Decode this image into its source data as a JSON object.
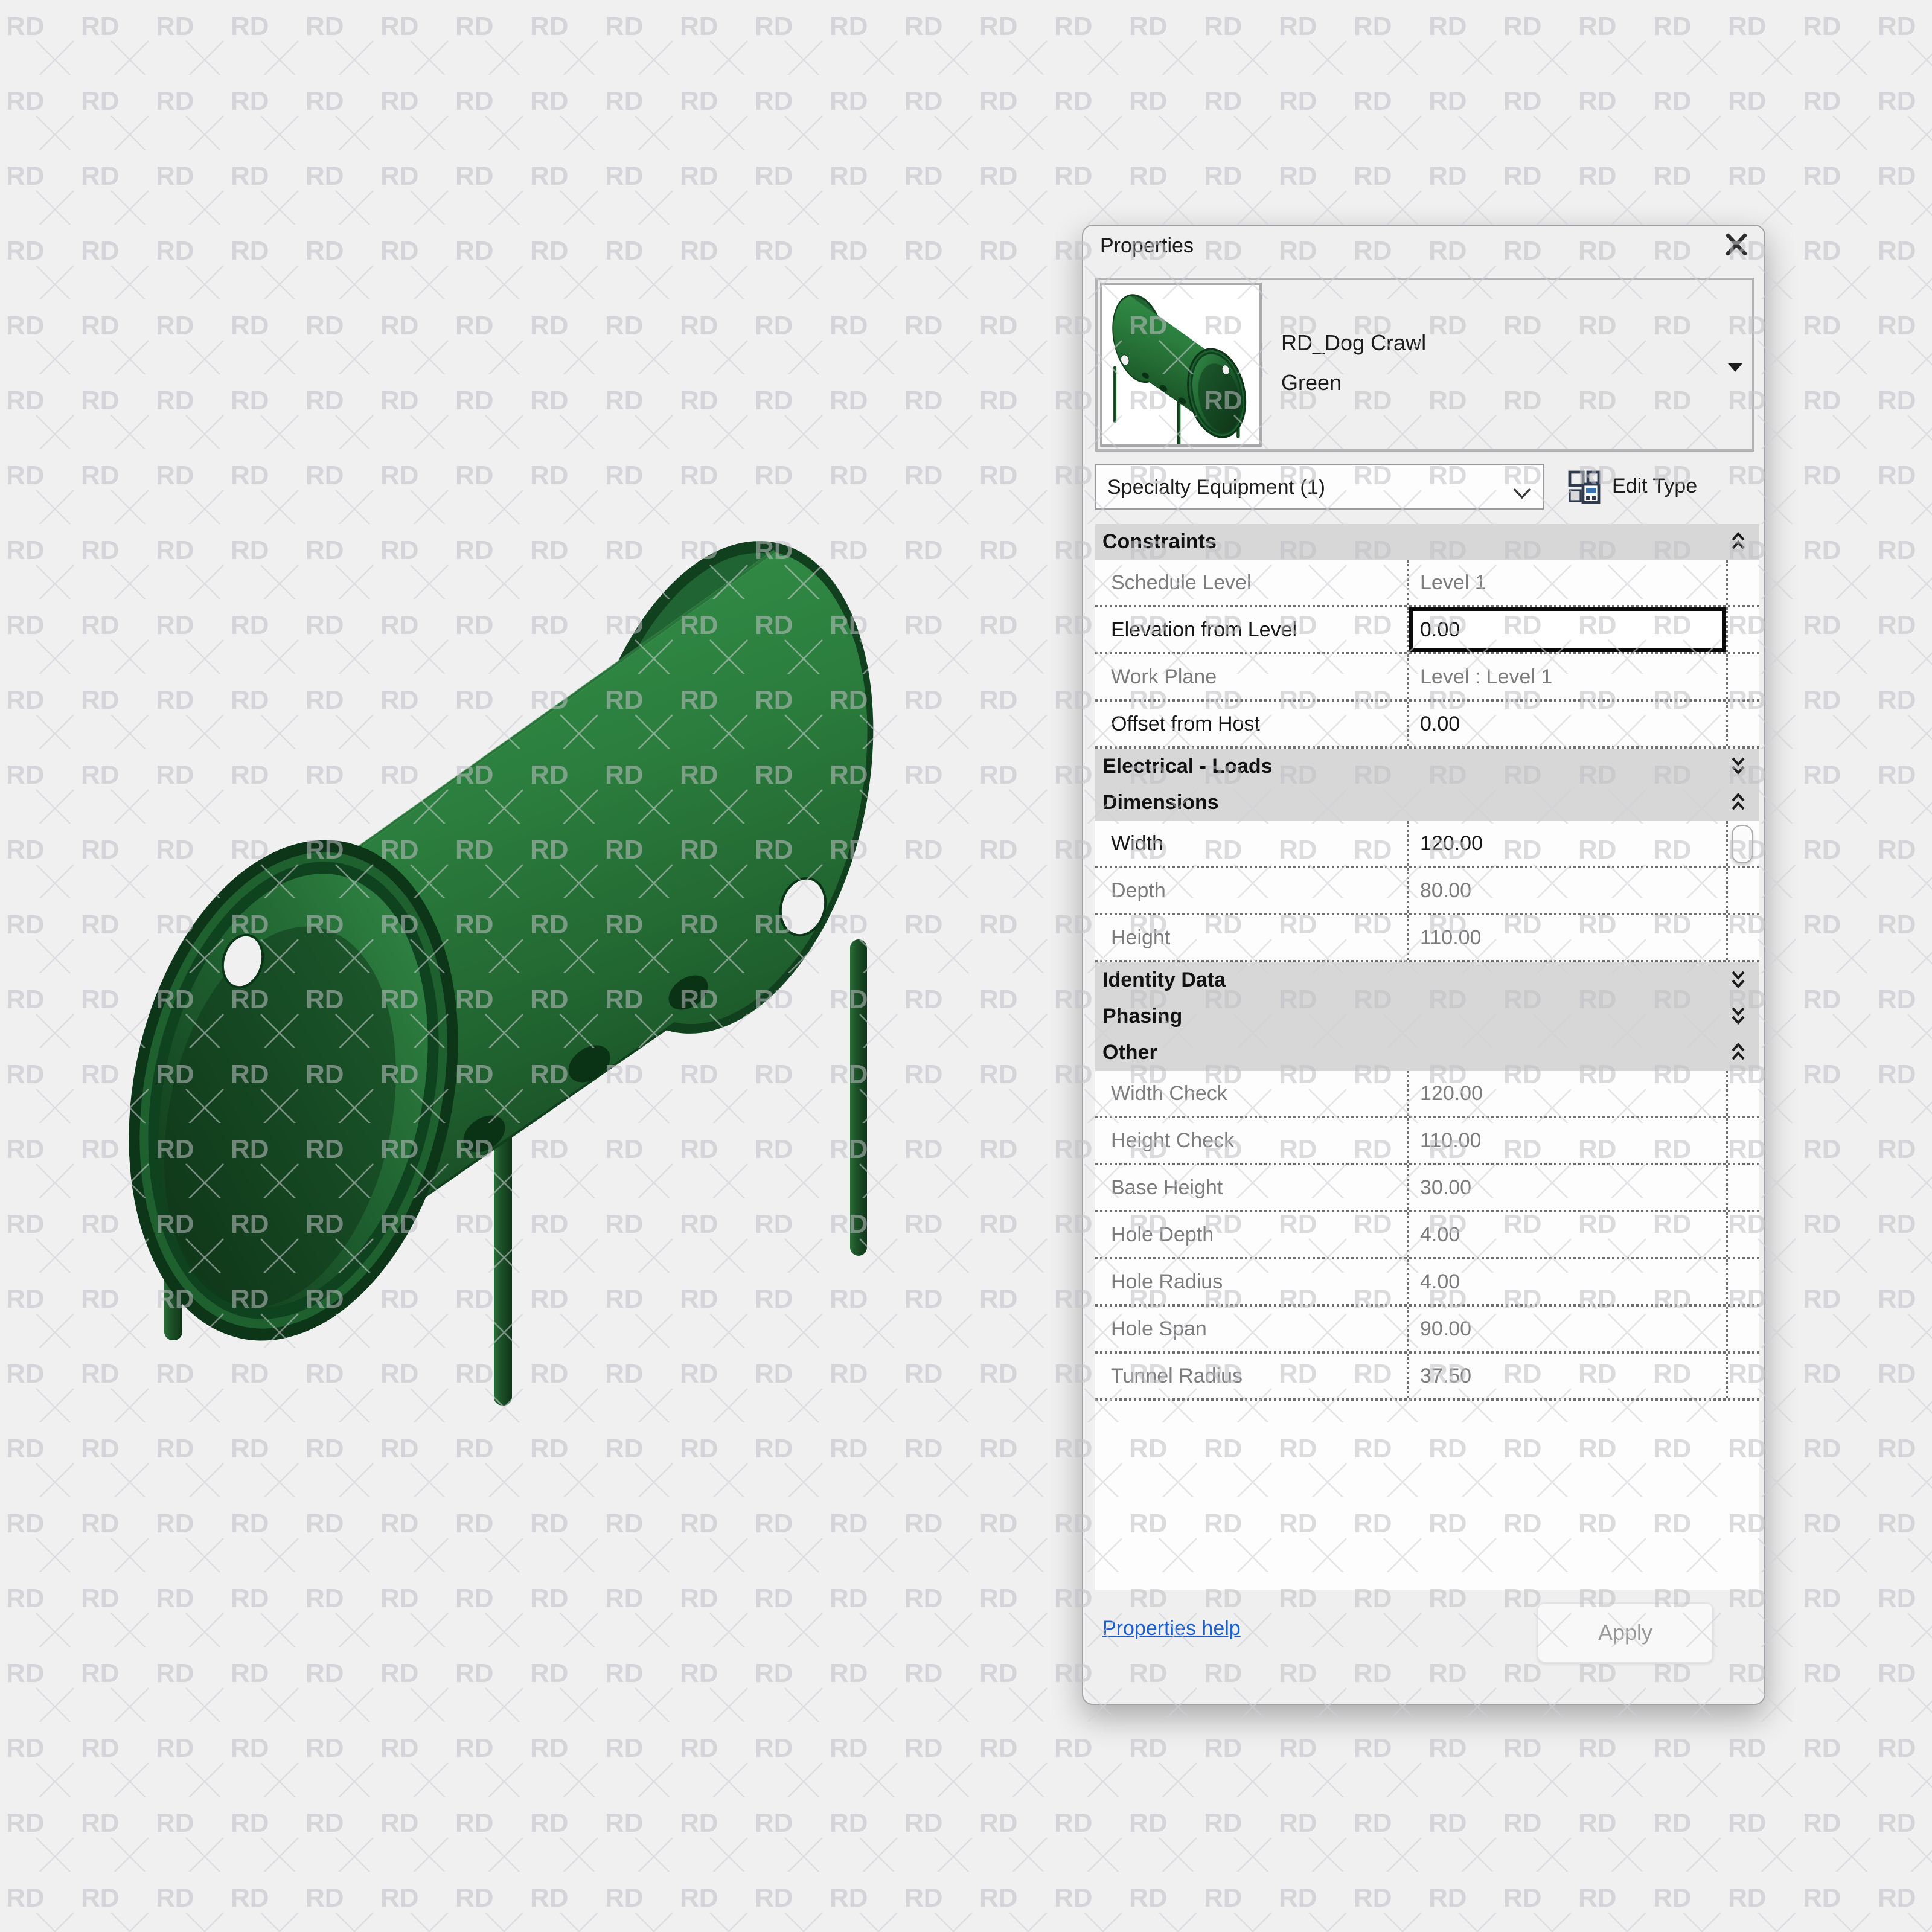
{
  "watermark": {
    "text": "RD"
  },
  "colors": {
    "canvas_bg": "#f0f0f1",
    "panel_bg": "#efeff0",
    "section_header_bg": "#d7d7d8",
    "tunnel_green": "#2b7d3d",
    "tunnel_dark_green": "#0d3619",
    "link_blue": "#1a5fd0",
    "focus_border": "#0a0a0a",
    "readonly_text": "#7d7d7f"
  },
  "panel": {
    "title": "Properties",
    "type_selector": {
      "family": "RD_Dog Crawl",
      "type_name": "Green"
    },
    "category_filter": {
      "selected": "Specialty Equipment (1)"
    },
    "edit_type": {
      "label": "Edit Type"
    },
    "sections": [
      {
        "label": "Constraints",
        "state": "expanded",
        "rows": [
          {
            "label": "Schedule Level",
            "value": "Level 1",
            "editable": false
          },
          {
            "label": "Elevation from Level",
            "value": "0.00",
            "editable": true,
            "focused": true
          },
          {
            "label": "Work Plane",
            "value": "Level : Level 1",
            "editable": false
          },
          {
            "label": "Offset from Host",
            "value": "0.00",
            "editable": true
          }
        ]
      },
      {
        "label": "Electrical - Loads",
        "state": "collapsed",
        "rows": []
      },
      {
        "label": "Dimensions",
        "state": "expanded",
        "rows": [
          {
            "label": "Width",
            "value": "120.00",
            "editable": true,
            "scrollbar": true
          },
          {
            "label": "Depth",
            "value": "80.00",
            "editable": false
          },
          {
            "label": "Height",
            "value": "110.00",
            "editable": false
          }
        ]
      },
      {
        "label": "Identity Data",
        "state": "collapsed",
        "rows": []
      },
      {
        "label": "Phasing",
        "state": "collapsed",
        "rows": []
      },
      {
        "label": "Other",
        "state": "expanded",
        "rows": [
          {
            "label": "Width Check",
            "value": "120.00",
            "editable": false
          },
          {
            "label": "Height Check",
            "value": "110.00",
            "editable": false
          },
          {
            "label": "Base Height",
            "value": "30.00",
            "editable": false
          },
          {
            "label": "Hole Depth",
            "value": "4.00",
            "editable": false
          },
          {
            "label": "Hole Radius",
            "value": "4.00",
            "editable": false
          },
          {
            "label": "Hole Span",
            "value": "90.00",
            "editable": false
          },
          {
            "label": "Tunnel Radius",
            "value": "37.50",
            "editable": false
          }
        ]
      }
    ],
    "footer": {
      "help_link": "Properties help",
      "apply_label": "Apply"
    }
  }
}
